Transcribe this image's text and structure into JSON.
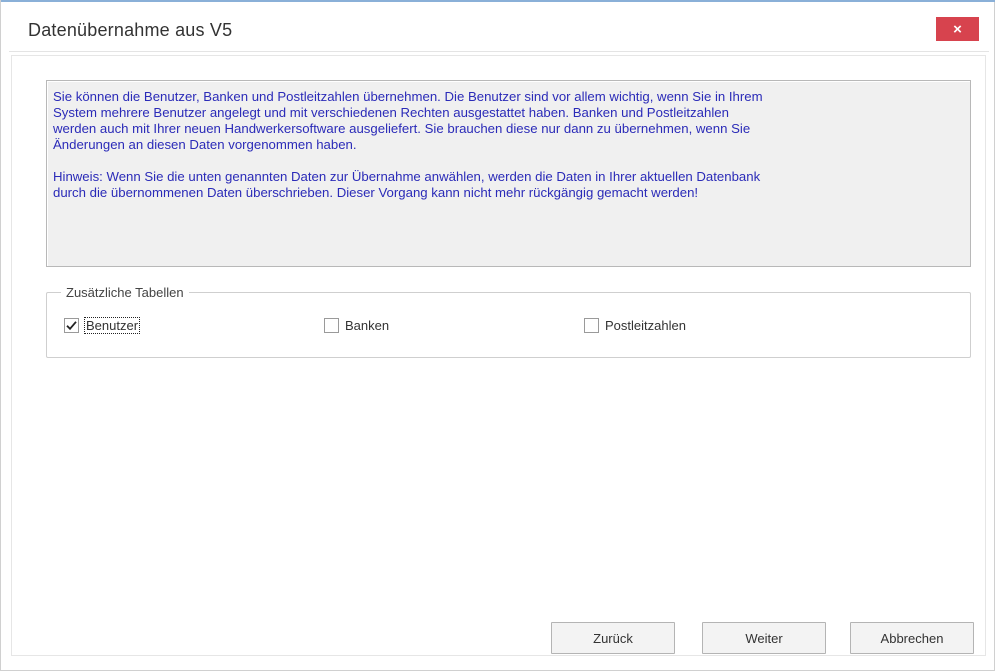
{
  "window": {
    "title": "Datenübernahme aus V5",
    "close_label": "×"
  },
  "info": {
    "paragraph1": "Sie können die Benutzer, Banken und Postleitzahlen übernehmen. Die Benutzer sind vor allem wichtig, wenn Sie in Ihrem\nSystem mehrere Benutzer angelegt und mit verschiedenen Rechten ausgestattet haben. Banken und Postleitzahlen\nwerden auch mit Ihrer neuen Handwerkersoftware ausgeliefert. Sie brauchen diese nur dann zu übernehmen, wenn Sie\nÄnderungen an diesen Daten vorgenommen haben.",
    "paragraph2": "Hinweis: Wenn Sie die unten genannten Daten zur Übernahme anwählen, werden die Daten in Ihrer aktuellen Datenbank\ndurch die übernommenen Daten überschrieben. Dieser Vorgang kann nicht mehr rückgängig gemacht werden!"
  },
  "group": {
    "legend": "Zusätzliche Tabellen",
    "options": [
      {
        "label": "Benutzer",
        "checked": true
      },
      {
        "label": "Banken",
        "checked": false
      },
      {
        "label": "Postleitzahlen",
        "checked": false
      }
    ]
  },
  "buttons": {
    "back": "Zurück",
    "next": "Weiter",
    "cancel": "Abbrechen"
  },
  "colors": {
    "close_button": "#d7434e",
    "info_text": "#2b2bb8",
    "info_background": "#f0f0f0"
  }
}
